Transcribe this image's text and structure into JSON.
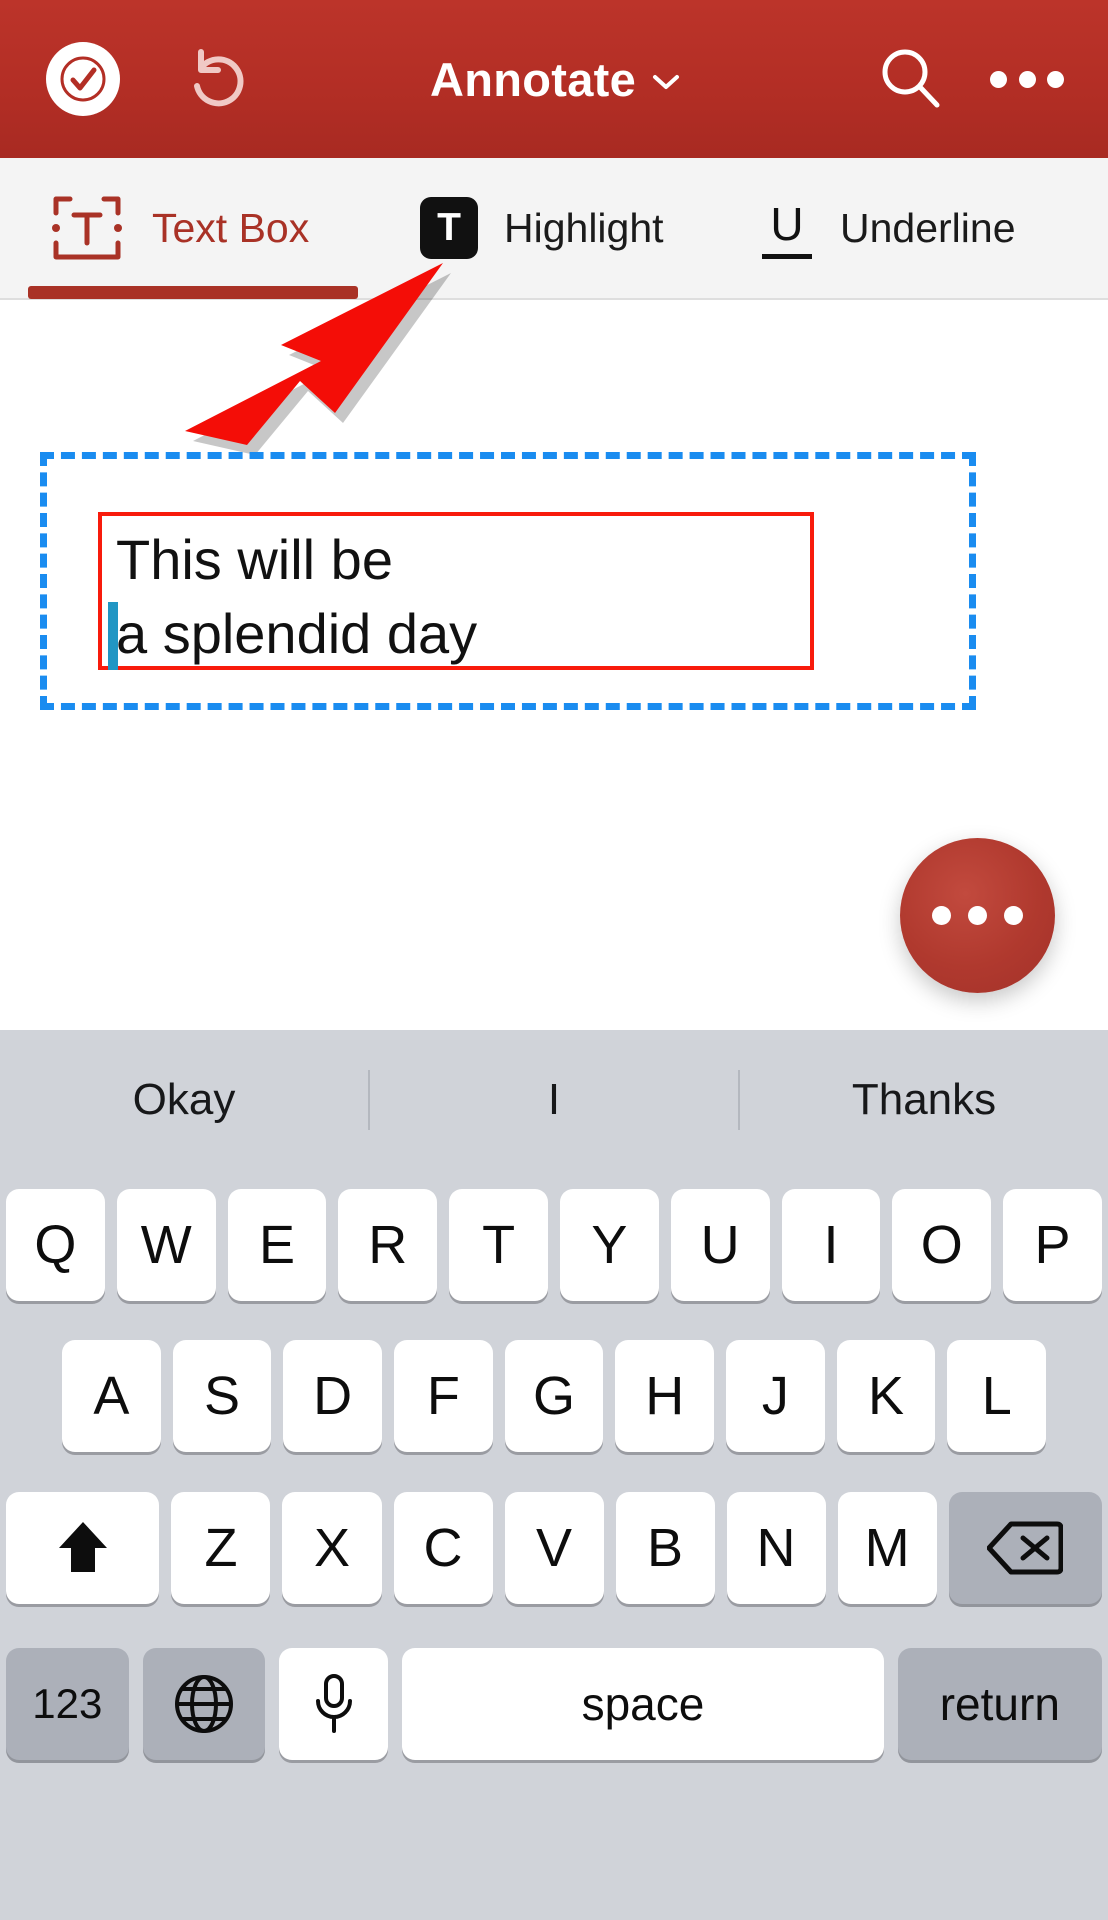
{
  "header": {
    "title": "Annotate",
    "caret_icon": "chevron-down-icon",
    "done_icon": "checkmark-circle-icon",
    "undo_icon": "undo-arrow-icon",
    "search_icon": "search-icon",
    "more_icon": "more-horizontal-icon",
    "background_color": "#b32e25",
    "text_color": "#ffffff"
  },
  "toolbar": {
    "active_tab": "Text Box",
    "accent_color": "#a93226",
    "tabs": [
      {
        "label": "Text Box",
        "icon": "text-box-icon",
        "active": true
      },
      {
        "label": "Highlight",
        "icon": "highlight-t-icon",
        "active": false
      },
      {
        "label": "Underline",
        "icon": "underline-u-icon",
        "active": false
      }
    ]
  },
  "canvas": {
    "cursor_icon": "arrow-cursor-icon",
    "cursor_color": "#f40d07",
    "selection_border_color": "#1a8cf0",
    "textbox_border_color": "#f81b0c",
    "caret_color": "#2196c4",
    "textbox": {
      "lines": [
        "This will be",
        "a splendid day"
      ]
    },
    "fab": {
      "icon": "more-horizontal-icon",
      "color": "#b0392e"
    }
  },
  "keyboard": {
    "suggestions": [
      "Okay",
      "I",
      "Thanks"
    ],
    "row1": [
      "Q",
      "W",
      "E",
      "R",
      "T",
      "Y",
      "U",
      "I",
      "O",
      "P"
    ],
    "row2": [
      "A",
      "S",
      "D",
      "F",
      "G",
      "H",
      "J",
      "K",
      "L"
    ],
    "row3_letters": [
      "Z",
      "X",
      "C",
      "V",
      "B",
      "N",
      "M"
    ],
    "shift_icon": "shift-arrow-up-icon",
    "backspace_icon": "backspace-delete-icon",
    "numbers_key": "123",
    "globe_icon": "globe-language-icon",
    "mic_icon": "microphone-icon",
    "space_key": "space",
    "return_key": "return",
    "background_color": "#d0d3d9",
    "key_color": "#ffffff",
    "modifier_key_color": "#acb0b9"
  }
}
